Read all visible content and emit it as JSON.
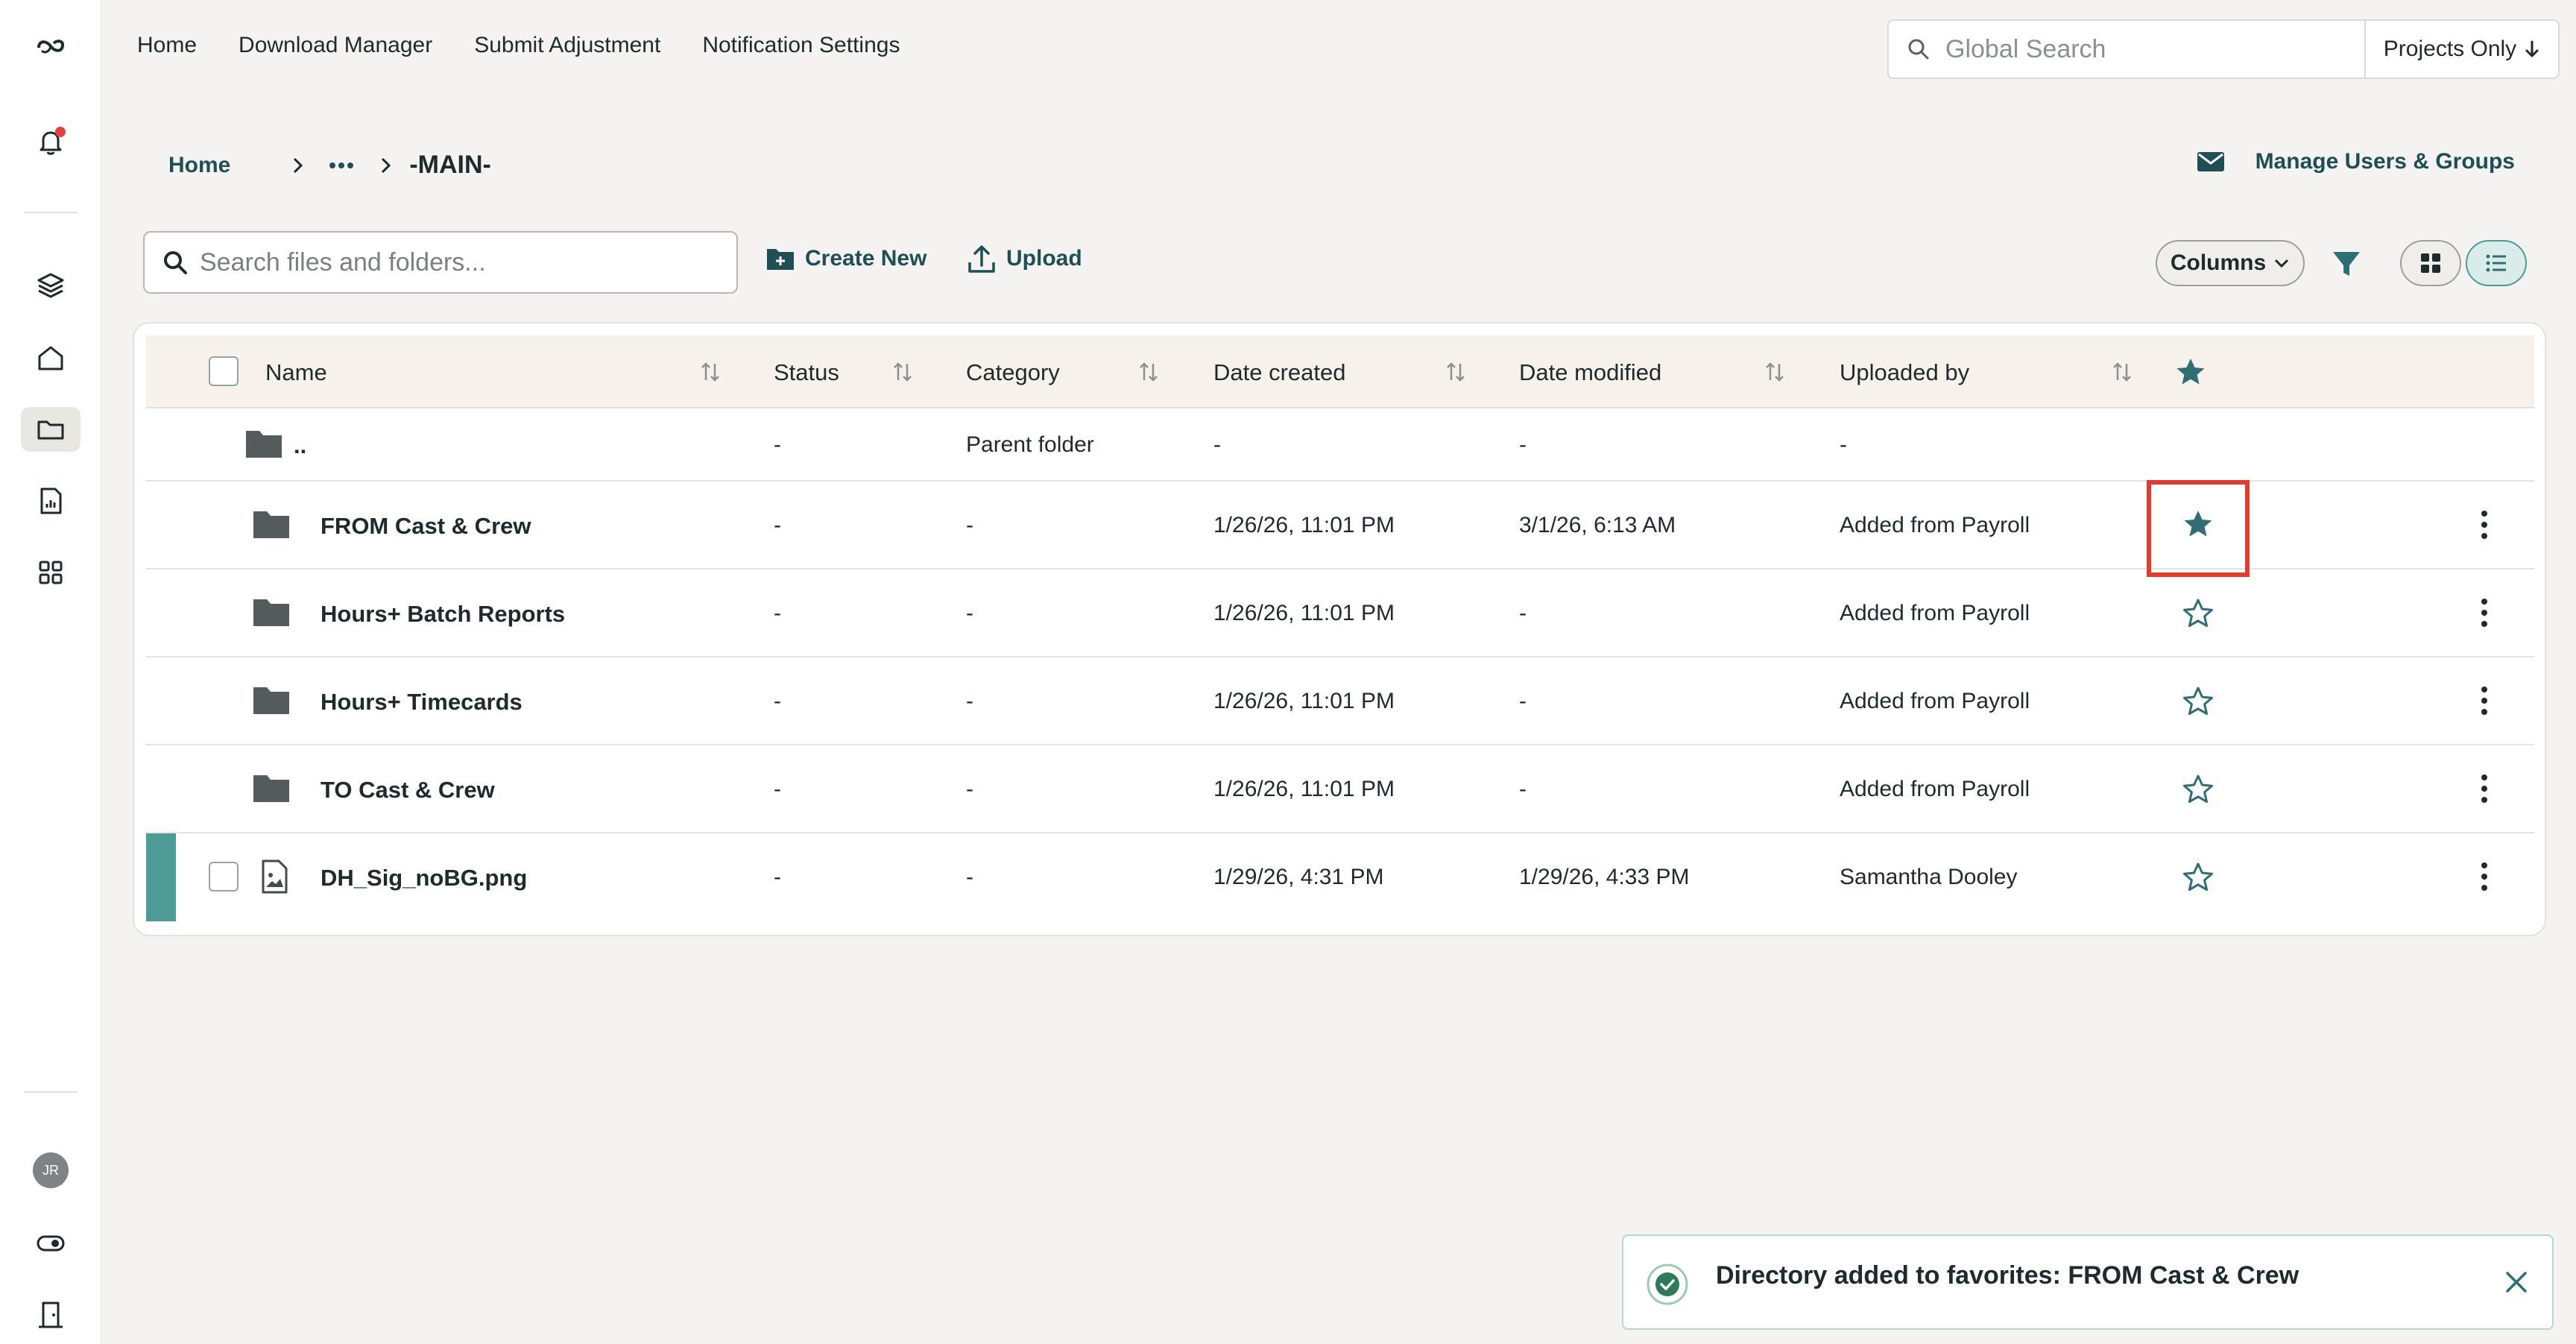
{
  "nav": {
    "items": [
      "Home",
      "Download Manager",
      "Submit Adjustment",
      "Notification Settings"
    ]
  },
  "global_search": {
    "placeholder": "Global Search",
    "scope_label": "Projects Only"
  },
  "breadcrumb": {
    "home": "Home",
    "current": "-MAIN-"
  },
  "manage_users": {
    "label": "Manage Users & Groups"
  },
  "toolbar": {
    "search_placeholder": "Search files and folders...",
    "create_new": "Create New",
    "upload": "Upload",
    "columns": "Columns"
  },
  "table": {
    "headers": {
      "name": "Name",
      "status": "Status",
      "category": "Category",
      "date_created": "Date created",
      "date_modified": "Date modified",
      "uploaded_by": "Uploaded by"
    },
    "parent_row": {
      "name": "..",
      "status": "-",
      "category": "Parent folder",
      "date_created": "-",
      "date_modified": "-",
      "uploaded_by": "-"
    },
    "rows": [
      {
        "name": "FROM Cast & Crew",
        "status": "-",
        "category": "-",
        "date_created": "1/26/26, 11:01 PM",
        "date_modified": "3/1/26, 6:13 AM",
        "uploaded_by": "Added from Payroll",
        "favorite": true,
        "type": "folder"
      },
      {
        "name": "Hours+ Batch Reports",
        "status": "-",
        "category": "-",
        "date_created": "1/26/26, 11:01 PM",
        "date_modified": "-",
        "uploaded_by": "Added from Payroll",
        "favorite": false,
        "type": "folder"
      },
      {
        "name": "Hours+ Timecards",
        "status": "-",
        "category": "-",
        "date_created": "1/26/26, 11:01 PM",
        "date_modified": "-",
        "uploaded_by": "Added from Payroll",
        "favorite": false,
        "type": "folder"
      },
      {
        "name": "TO Cast & Crew",
        "status": "-",
        "category": "-",
        "date_created": "1/26/26, 11:01 PM",
        "date_modified": "-",
        "uploaded_by": "Added from Payroll",
        "favorite": false,
        "type": "folder"
      },
      {
        "name": "DH_Sig_noBG.png",
        "status": "-",
        "category": "-",
        "date_created": "1/29/26, 4:31 PM",
        "date_modified": "1/29/26, 4:33 PM",
        "uploaded_by": "Samantha Dooley",
        "favorite": false,
        "type": "image-file"
      }
    ]
  },
  "user": {
    "initials": "JR"
  },
  "toast": {
    "message": "Directory added to favorites: FROM Cast & Crew"
  },
  "colors": {
    "accent": "#1d4f55",
    "teal": "#4e9a95",
    "highlight": "#e53b2f",
    "header_bg": "#f6f1ea"
  }
}
